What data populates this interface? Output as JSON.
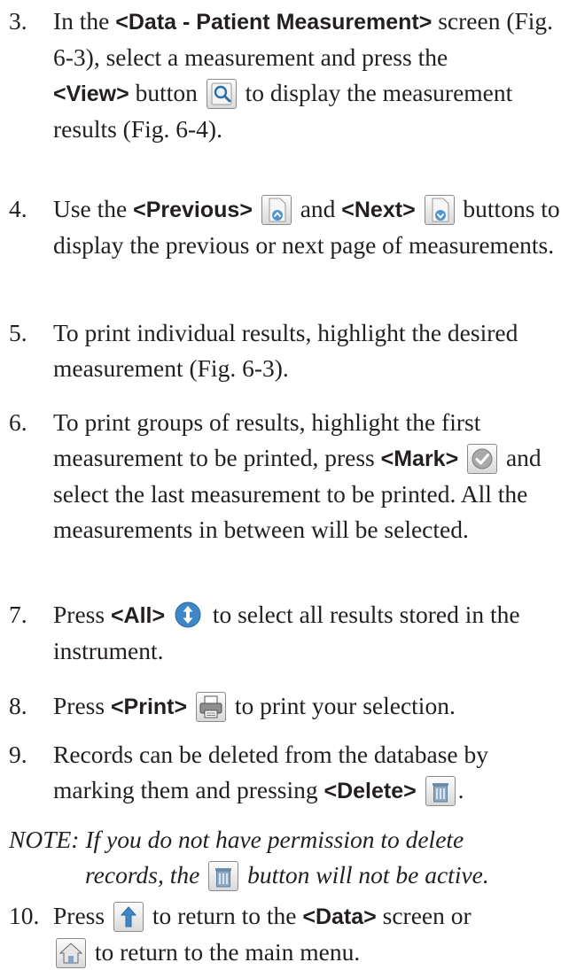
{
  "step3": {
    "num": "3.",
    "t1": "In the ",
    "k1": "<Data - Patient Measurement>",
    "t2": " screen (Fig. 6-3), select a measurement and press the",
    "k2": "<View>",
    "t3": " button ",
    "t4": " to display the measurement results (Fig. 6-4)."
  },
  "step4": {
    "num": "4.",
    "t1": "Use the ",
    "k1": "<Previous>",
    "t2": " and ",
    "k2": "<Next>",
    "t3": " buttons to display the previous or next page of measurements."
  },
  "step5": {
    "num": "5.",
    "t1": "To print individual results, highlight the desired measurement (Fig. 6-3)."
  },
  "step6": {
    "num": "6.",
    "t1": "To print groups of results, highlight the first measurement to be printed, press ",
    "k1": "<Mark>",
    "t2": " and select the last measurement to be printed. All the measurements in between will be selected."
  },
  "step7": {
    "num": "7.",
    "t1": "Press ",
    "k1": "<All>",
    "t2": " to select all results stored in the instrument."
  },
  "step8": {
    "num": "8.",
    "t1": "Press ",
    "k1": "<Print>",
    "t2": " to print your selection."
  },
  "step9": {
    "num": "9.",
    "t1": "Records can be deleted from the database by marking them and pressing ",
    "k1": "<Delete>",
    "t2": "."
  },
  "note": {
    "t1": "NOTE: If you do not have permission to delete",
    "t2": "records, the ",
    "t3": " button will not be active."
  },
  "step10": {
    "num": "10.",
    "t1": "Press ",
    "t2": " to return to the ",
    "k1": "<Data>",
    "t3": " screen or",
    "t4": " to return to the main menu."
  },
  "icons": {
    "view": "magnifier-icon",
    "previous": "page-up-arrow-icon",
    "next": "page-down-arrow-icon",
    "mark": "checkmark-icon",
    "all": "up-down-arrow-icon",
    "print": "printer-icon",
    "delete": "trash-icon",
    "back": "up-arrow-icon",
    "home": "home-icon"
  }
}
